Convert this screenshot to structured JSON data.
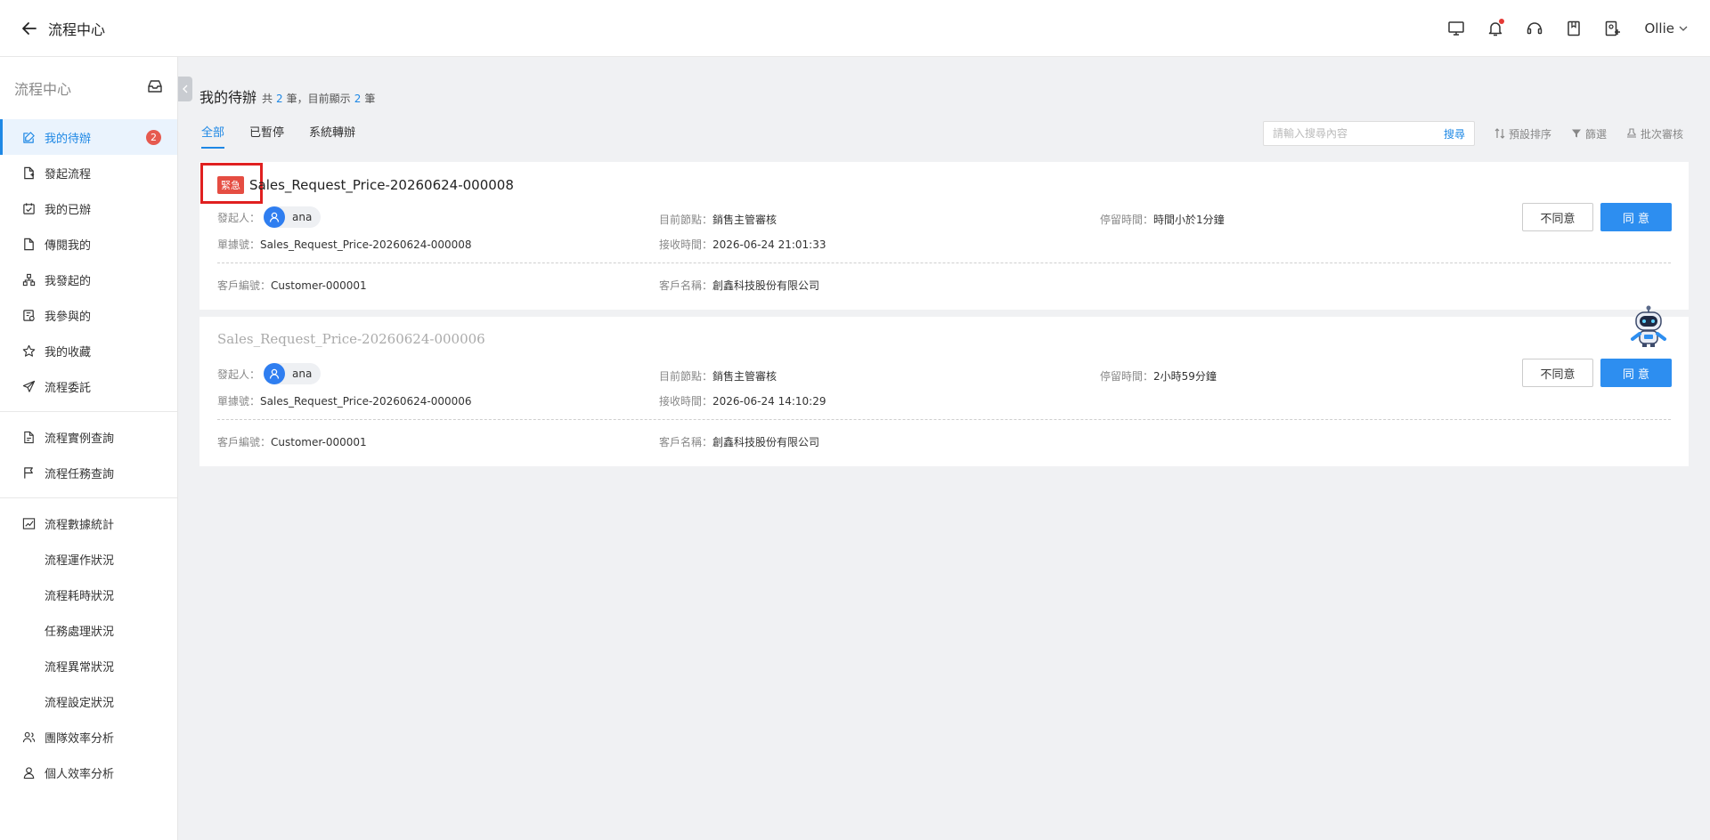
{
  "header": {
    "title": "流程中心",
    "user": "Ollie"
  },
  "sidebar": {
    "title": "流程中心",
    "groups": [
      [
        {
          "label": "我的待辦",
          "icon": "edit-icon",
          "badge": "2",
          "active": true
        },
        {
          "label": "發起流程",
          "icon": "file-add-icon"
        },
        {
          "label": "我的已辦",
          "icon": "calendar-check-icon"
        },
        {
          "label": "傳閱我的",
          "icon": "file-icon"
        },
        {
          "label": "我發起的",
          "icon": "flow-icon"
        },
        {
          "label": "我參與的",
          "icon": "participate-icon"
        },
        {
          "label": "我的收藏",
          "icon": "star-icon"
        },
        {
          "label": "流程委託",
          "icon": "send-icon"
        }
      ],
      [
        {
          "label": "流程實例查詢",
          "icon": "file-search-icon"
        },
        {
          "label": "流程任務查詢",
          "icon": "flag-icon"
        }
      ],
      [
        {
          "label": "流程數據統計",
          "icon": "chart-icon"
        },
        {
          "label": "流程運作狀況",
          "sub": true
        },
        {
          "label": "流程耗時狀況",
          "sub": true
        },
        {
          "label": "任務處理狀況",
          "sub": true
        },
        {
          "label": "流程異常狀況",
          "sub": true
        },
        {
          "label": "流程設定狀況",
          "sub": true
        },
        {
          "label": "團隊效率分析",
          "icon": "team-icon"
        },
        {
          "label": "個人效率分析",
          "icon": "person-icon"
        }
      ]
    ]
  },
  "main": {
    "title": "我的待辦",
    "count_prefix": "共",
    "total": "2",
    "count_mid": "筆，目前顯示",
    "shown": "2",
    "count_suffix": "筆",
    "tabs": [
      "全部",
      "已暫停",
      "系統轉辦"
    ],
    "search_placeholder": "請輸入搜尋內容",
    "search_label": "搜尋",
    "sort_label": "預設排序",
    "filter_label": "篩選",
    "batch_label": "批次審核"
  },
  "labels": {
    "initiator": "發起人：",
    "doc_no": "單據號：",
    "customer_no": "客戶編號：",
    "node": "目前節點：",
    "received": "接收時間：",
    "customer_name": "客戶名稱：",
    "stay": "停留時間：",
    "reject": "不同意",
    "approve": "同 意",
    "urgent": "緊急"
  },
  "tasks": [
    {
      "title": "Sales_Request_Price-20260624-000008",
      "urgent": true,
      "initiator": "ana",
      "doc_no": "Sales_Request_Price-20260624-000008",
      "customer_no": "Customer-000001",
      "node": "銷售主管審核",
      "received": "2026-06-24 21:01:33",
      "customer_name": "創鑫科技股份有限公司",
      "stay": "時間小於1分鐘"
    },
    {
      "title": "Sales_Request_Price-20260624-000006",
      "urgent": false,
      "initiator": "ana",
      "doc_no": "Sales_Request_Price-20260624-000006",
      "customer_no": "Customer-000001",
      "node": "銷售主管審核",
      "received": "2026-06-24 14:10:29",
      "customer_name": "創鑫科技股份有限公司",
      "stay": "2小時59分鐘"
    }
  ]
}
